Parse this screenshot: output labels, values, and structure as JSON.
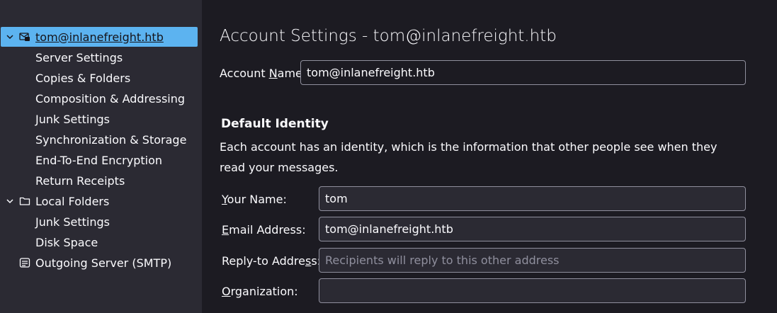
{
  "sidebar": {
    "account": {
      "label": "tom@inlanefreight.htb",
      "icon": "mail-account-icon",
      "expanded": true
    },
    "account_children": [
      "Server Settings",
      "Copies & Folders",
      "Composition & Addressing",
      "Junk Settings",
      "Synchronization & Storage",
      "End-To-End Encryption",
      "Return Receipts"
    ],
    "local_folders": {
      "label": "Local Folders",
      "icon": "folder-icon",
      "expanded": true
    },
    "local_children": [
      "Junk Settings",
      "Disk Space"
    ],
    "outgoing": {
      "label": "Outgoing Server (SMTP)",
      "icon": "outgoing-server-icon"
    }
  },
  "main": {
    "title": "Account Settings - tom@inlanefreight.htb",
    "account_name": {
      "label_pre": "Account ",
      "label_key": "N",
      "label_post": "ame:",
      "value": "tom@inlanefreight.htb"
    },
    "identity": {
      "heading": "Default Identity",
      "description": "Each account has an identity, which is the information that other people see when they read your messages.",
      "your_name": {
        "label_key": "Y",
        "label_rest": "our Name:",
        "value": "tom"
      },
      "email": {
        "label_key": "E",
        "label_rest": "mail Address:",
        "value": "tom@inlanefreight.htb"
      },
      "reply_to": {
        "label_pre": "Reply-to Addre",
        "label_key": "s",
        "label_post": "s:",
        "placeholder": "Recipients will reply to this other address"
      },
      "organization": {
        "label_key": "O",
        "label_rest": "rganization:",
        "value": ""
      }
    }
  },
  "colors": {
    "sidebar_bg": "#2b2a33",
    "main_bg": "#1c1b22",
    "selection": "#5cb3f0",
    "border": "#8f8f9d"
  }
}
